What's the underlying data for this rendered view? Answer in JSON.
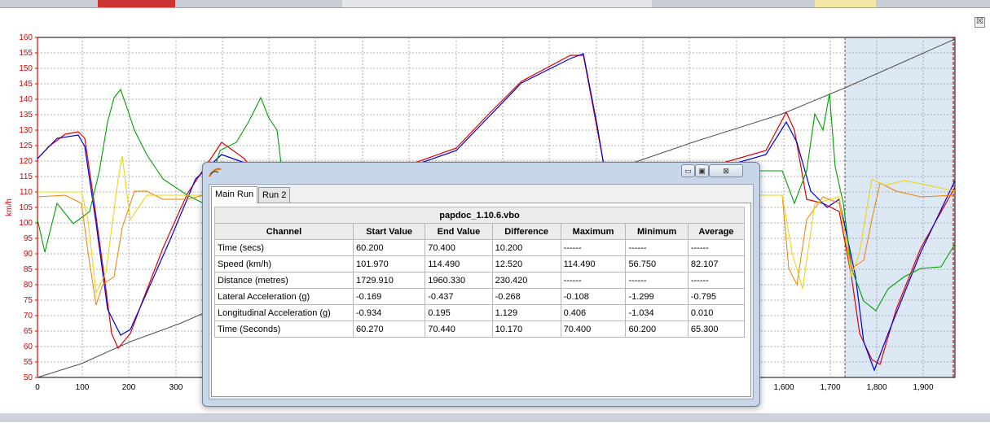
{
  "chart": {
    "ylabel": "km/h",
    "y_ticks": [
      "160",
      "155",
      "150",
      "145",
      "140",
      "135",
      "130",
      "125",
      "120",
      "115",
      "110",
      "105",
      "100",
      "95",
      "90",
      "85",
      "80",
      "75",
      "70",
      "65",
      "60",
      "55",
      "50"
    ],
    "x_ticks": [
      "0",
      "100",
      "200",
      "300",
      "1,600",
      "1,700",
      "1,800",
      "1,900"
    ],
    "colors": {
      "red": "#e00000",
      "blue": "#0000e0",
      "green": "#00a000",
      "orange": "#f08000",
      "yellow": "#f0d000",
      "grey": "#505050",
      "highlight": "#dde8f5"
    }
  },
  "window": {
    "close_glyph": "☒"
  },
  "dialog": {
    "tabs": [
      "Main Run",
      "Run 2"
    ],
    "minimize_glyph": "▭",
    "maximize_glyph": "▣",
    "close_glyph": "⊠",
    "file_title": "papdoc_1.10.6.vbo",
    "columns": [
      "Channel",
      "Start Value",
      "End Value",
      "Difference",
      "Maximum",
      "Minimum",
      "Average"
    ],
    "rows": [
      [
        "Time (secs)",
        "60.200",
        "70.400",
        "10.200",
        "------",
        "------",
        "------"
      ],
      [
        "Speed (km/h)",
        "101.970",
        "114.490",
        "12.520",
        "114.490",
        "56.750",
        "82.107"
      ],
      [
        "Distance (metres)",
        "1729.910",
        "1960.330",
        "230.420",
        "------",
        "------",
        "------"
      ],
      [
        "Lateral Acceleration (g)",
        "-0.169",
        "-0.437",
        "-0.268",
        "-0.108",
        "-1.299",
        "-0.795"
      ],
      [
        "Longitudinal Acceleration (g)",
        "-0.934",
        "0.195",
        "1.129",
        "0.406",
        "-1.034",
        "0.010"
      ],
      [
        "Time (Seconds)",
        "60.270",
        "70.440",
        "10.170",
        "70.400",
        "60.200",
        "65.300"
      ]
    ]
  }
}
